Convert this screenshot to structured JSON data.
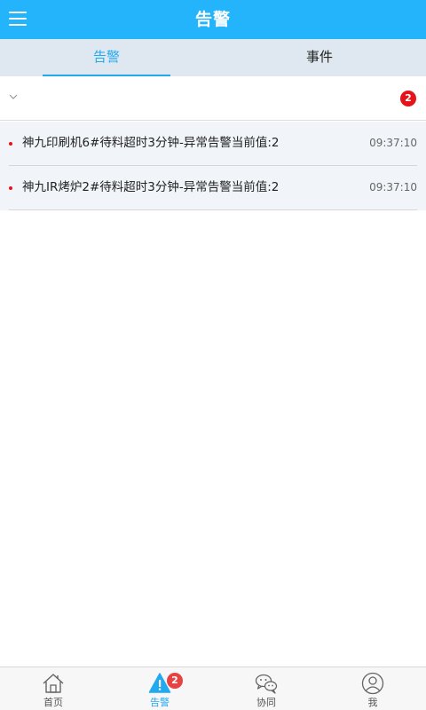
{
  "header": {
    "title": "告警",
    "menu_icon": "hamburger-menu-icon"
  },
  "tabs": [
    {
      "label": "告警",
      "active": true
    },
    {
      "label": "事件",
      "active": false
    }
  ],
  "group": {
    "expand_icon": "chevron-down-icon",
    "count": "2"
  },
  "alarms": [
    {
      "text": "神九印刷机6#待料超时3分钟-异常告警当前值:2",
      "time": "09:37:10"
    },
    {
      "text": "神九IR烤炉2#待料超时3分钟-异常告警当前值:2",
      "time": "09:37:10"
    }
  ],
  "nav": [
    {
      "label": "首页",
      "icon": "home-icon",
      "active": false
    },
    {
      "label": "告警",
      "icon": "warning-icon",
      "active": true,
      "badge": "2"
    },
    {
      "label": "协同",
      "icon": "chat-icon",
      "active": false
    },
    {
      "label": "我",
      "icon": "user-icon",
      "active": false
    }
  ],
  "colors": {
    "primary": "#23b4fb",
    "accent": "#23a9ee",
    "tab_bar": "#dfe8f1",
    "badge": "#e5141a",
    "list_bg": "#f1f4f8"
  }
}
